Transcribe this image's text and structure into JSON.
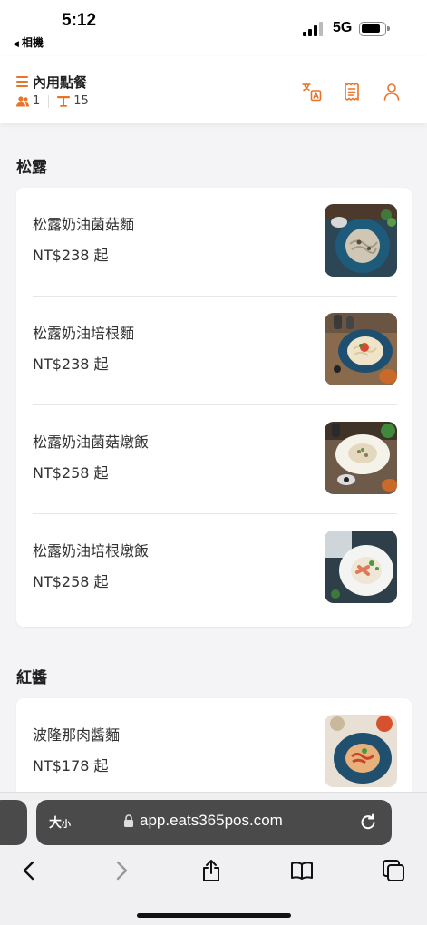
{
  "status_bar": {
    "time": "5:12",
    "back_app": "相機",
    "network": "5G"
  },
  "header": {
    "title": "內用點餐",
    "guests": "1",
    "table": "15",
    "accent": "#e8742a",
    "icons": [
      "menu-icon",
      "people-icon",
      "table-icon",
      "translate-icon",
      "receipt-icon",
      "user-icon"
    ]
  },
  "sections": [
    {
      "title": "松露",
      "items": [
        {
          "name": "松露奶油菌菇麵",
          "price": "NT$238 起"
        },
        {
          "name": "松露奶油培根麵",
          "price": "NT$238 起"
        },
        {
          "name": "松露奶油菌菇燉飯",
          "price": "NT$258 起"
        },
        {
          "name": "松露奶油培根燉飯",
          "price": "NT$258 起"
        }
      ]
    },
    {
      "title": "紅醬",
      "items": [
        {
          "name": "波隆那肉醬麵",
          "price": "NT$178 起"
        }
      ]
    }
  ],
  "browser": {
    "text_size_label": "大",
    "text_size_small": "小",
    "url": "app.eats365pos.com",
    "toolbar": [
      "back-icon",
      "forward-icon",
      "share-icon",
      "bookmarks-icon",
      "tabs-icon"
    ]
  }
}
